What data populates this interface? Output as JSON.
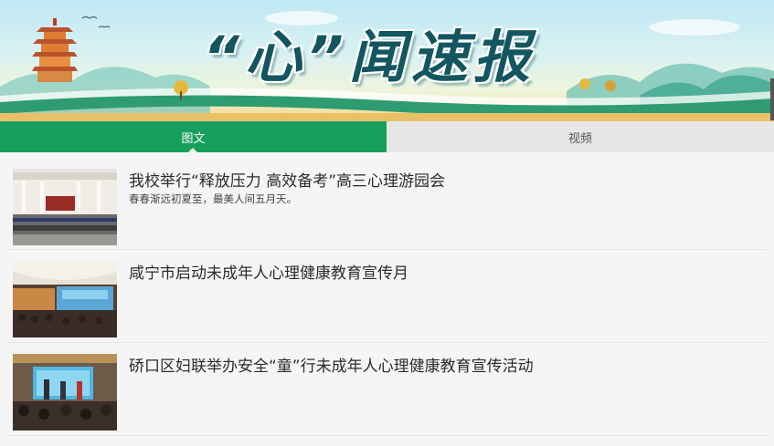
{
  "banner": {
    "title": "“心”闻速报",
    "pagoda_icon": "pagoda-icon"
  },
  "colors": {
    "accent": "#17a05d",
    "tab_inactive_bg": "#e7e7e7",
    "banner_title": "#14565f"
  },
  "tabs": [
    {
      "label": "图文",
      "active": true
    },
    {
      "label": "视频",
      "active": false
    }
  ],
  "articles": [
    {
      "title": "我校举行“释放压力 高效备考”高三心理游园会",
      "desc": "春春渐远初夏至，最美人间五月天。",
      "thumb": "school-building-photo"
    },
    {
      "title": "咸宁市启动未成年人心理健康教育宣传月",
      "desc": "",
      "thumb": "auditorium-stage-photo"
    },
    {
      "title": "硚口区妇联举办安全“童”行未成年人心理健康教育宣传活动",
      "desc": "",
      "thumb": "presentation-audience-photo"
    }
  ]
}
